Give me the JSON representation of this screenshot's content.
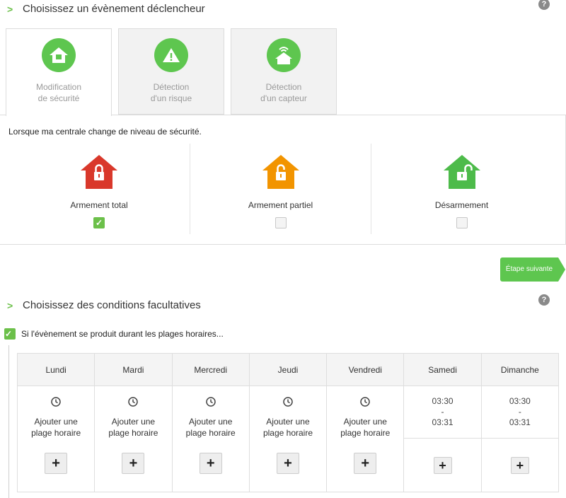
{
  "trigger": {
    "title": "Choisissez un évènement déclencheur",
    "help": "?",
    "tabs": [
      {
        "label": "Modification\nde sécurité",
        "icon": "house-icon"
      },
      {
        "label": "Détection\nd'un risque",
        "icon": "warning-icon"
      },
      {
        "label": "Détection\nd'un capteur",
        "icon": "sensor-house-icon"
      }
    ],
    "description": "Lorsque ma centrale change de niveau de sécurité.",
    "levels": [
      {
        "label": "Armement total",
        "color": "#d9382b",
        "icon": "locked-house-icon",
        "checked": true
      },
      {
        "label": "Armement partiel",
        "color": "#f29400",
        "icon": "unlocked-house-icon",
        "checked": false
      },
      {
        "label": "Désarmement",
        "color": "#4dbb4a",
        "icon": "open-lock-house-icon",
        "checked": false
      }
    ],
    "check_mark": "✓"
  },
  "next_button": "Étape suivante",
  "conditions": {
    "title": "Choisissez des conditions facultatives",
    "help": "?",
    "time_condition": "Si l'évènement se produit durant les plages horaires...",
    "time_condition_checked": true,
    "days": [
      "Lundi",
      "Mardi",
      "Mercredi",
      "Jeudi",
      "Vendredi",
      "Samedi",
      "Dimanche"
    ],
    "add_label": "Ajouter une\nplage horaire",
    "plus": "+",
    "weekend_slot": "03:30\n-\n03:31"
  },
  "colors": {
    "accent": "#5ec64f"
  }
}
